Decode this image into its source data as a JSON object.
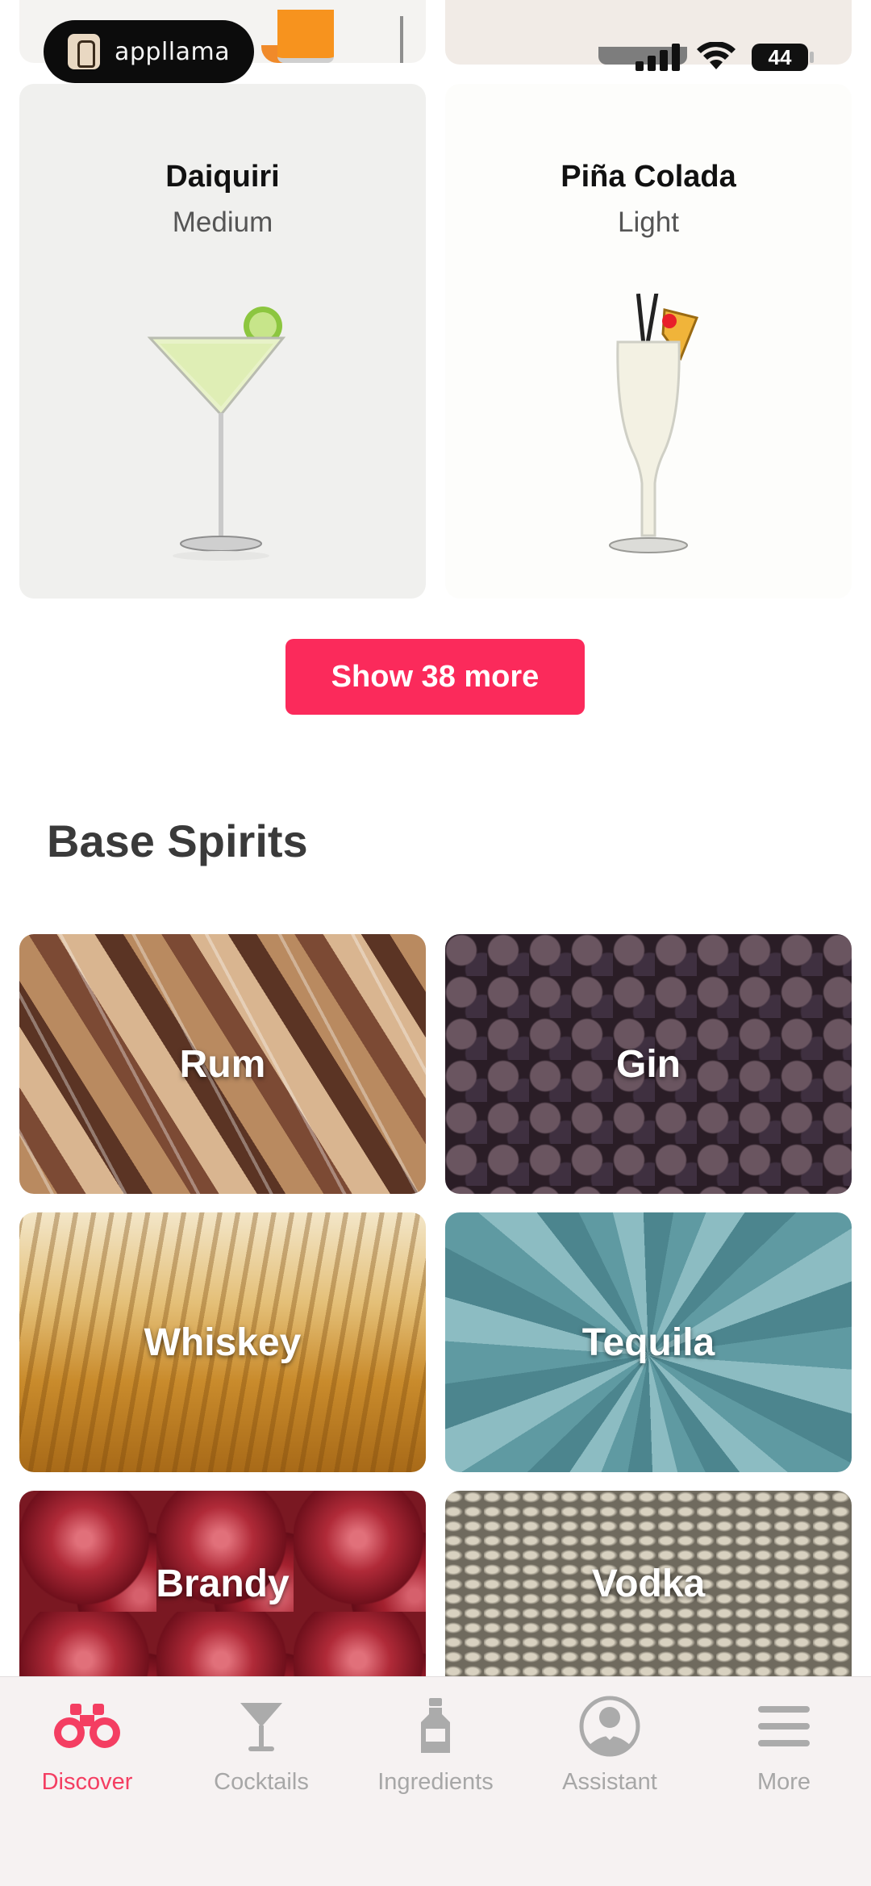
{
  "badge": {
    "text": "appllama"
  },
  "status_bar": {
    "battery": "44"
  },
  "cocktails": [
    {
      "name": "Daiquiri",
      "strength": "Medium"
    },
    {
      "name": "Piña Colada",
      "strength": "Light"
    }
  ],
  "show_more": {
    "label": "Show 38 more"
  },
  "base_spirits": {
    "title": "Base Spirits",
    "items": [
      "Rum",
      "Gin",
      "Whiskey",
      "Tequila",
      "Brandy",
      "Vodka"
    ]
  },
  "tabbar": {
    "active": "Discover",
    "accent_color": "#f43e62",
    "items": [
      {
        "label": "Discover",
        "icon": "binoculars-icon"
      },
      {
        "label": "Cocktails",
        "icon": "cocktail-glass-icon"
      },
      {
        "label": "Ingredients",
        "icon": "bottle-icon"
      },
      {
        "label": "Assistant",
        "icon": "bartender-icon"
      },
      {
        "label": "More",
        "icon": "hamburger-menu-icon"
      }
    ]
  }
}
